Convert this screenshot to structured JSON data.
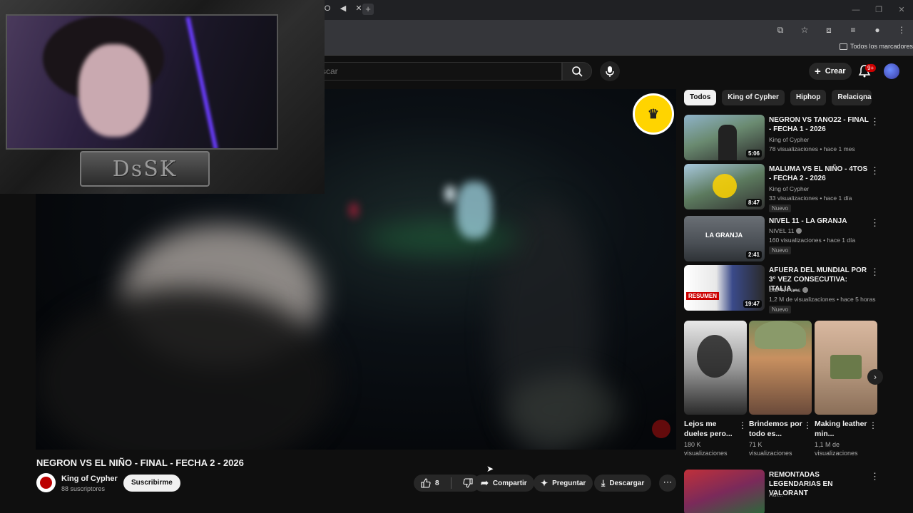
{
  "browser": {
    "tab_controls": [
      "O",
      "◀",
      "✕"
    ],
    "bookmarks_label": "Todos los marcadores"
  },
  "header": {
    "search_placeholder": "scar",
    "create_label": "Crear",
    "notification_count": "9+"
  },
  "player": {
    "overlay_text": "DsSK"
  },
  "video": {
    "title": "NEGRON VS EL NIÑO - FINAL - FECHA 2 - 2026",
    "channel": "King of Cypher",
    "subscribers": "88 suscriptores",
    "subscribe_label": "Suscribirme",
    "likes": "8",
    "share_label": "Compartir",
    "ask_label": "Preguntar",
    "download_label": "Descargar"
  },
  "sidebar": {
    "chips": [
      "Todos",
      "King of Cypher",
      "Hiphop",
      "Relaciona"
    ],
    "videos": [
      {
        "title": "NEGRON VS TANO22 - FINAL - FECHA 1 - 2026",
        "channel": "King of Cypher",
        "meta": "78 visualizaciones • hace 1 mes",
        "duration": "5:06",
        "badge": ""
      },
      {
        "title": "MALUMA VS EL NIÑO - 4TOS - FECHA 2 - 2026",
        "channel": "King of Cypher",
        "meta": "33 visualizaciones • hace 1 día",
        "duration": "8:47",
        "badge": "Nuevo"
      },
      {
        "title": "NIVEL 11 - LA GRANJA",
        "channel": "NIVEL 11",
        "meta": "160 visualizaciones • hace 1 día",
        "duration": "2:41",
        "badge": "Nuevo",
        "thumb_text": "LA GRANJA"
      },
      {
        "title": "AFUERA DEL MUNDIAL POR 3° VEZ CONSECUTIVA: ITALIA ...",
        "channel": "ESPN Fans",
        "meta": "1,2 M de visualizaciones • hace 5 horas",
        "duration": "19:47",
        "badge": "Nuevo",
        "thumb_text": "RESUMEN"
      },
      {
        "title": "REMONTADAS LEGENDARIAS EN VALORANT",
        "channel": "Aur...",
        "meta": "",
        "duration": "",
        "badge": ""
      }
    ],
    "shorts": [
      {
        "title": "Lejos me dueles pero...",
        "views": "180 K visualizaciones"
      },
      {
        "title": "Brindemos por todo es...",
        "views": "71 K visualizaciones"
      },
      {
        "title": "Making leather min...",
        "views": "1,1 M de visualizaciones"
      }
    ]
  }
}
